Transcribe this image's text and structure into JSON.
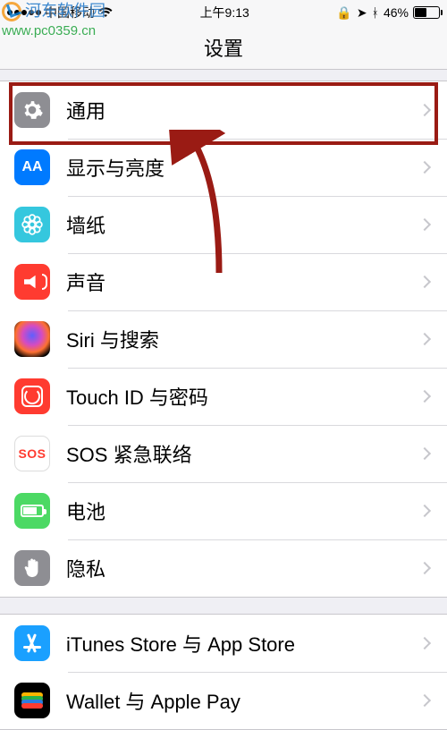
{
  "watermark": {
    "text": "河东软件园",
    "url": "www.pc0359.cn"
  },
  "status": {
    "carrier": "中国移动",
    "time": "上午9:13",
    "orientation_lock": "⊕",
    "location": "➤",
    "bluetooth": "✱",
    "battery_pct": "46%"
  },
  "title": "设置",
  "groups": [
    {
      "items": [
        {
          "key": "general",
          "label": "通用",
          "icon": "gear-icon",
          "bg": "bg-gray"
        },
        {
          "key": "display",
          "label": "显示与亮度",
          "icon": "display-icon",
          "bg": "bg-blue"
        },
        {
          "key": "wallpaper",
          "label": "墙纸",
          "icon": "wallpaper-icon",
          "bg": "bg-cyan"
        },
        {
          "key": "sound",
          "label": "声音",
          "icon": "sound-icon",
          "bg": "bg-red"
        },
        {
          "key": "siri",
          "label": "Siri 与搜索",
          "icon": "siri-icon",
          "bg": "bg-black"
        },
        {
          "key": "touchid",
          "label": "Touch ID 与密码",
          "icon": "touchid-icon",
          "bg": "bg-dred"
        },
        {
          "key": "sos",
          "label": "SOS 紧急联络",
          "icon": "sos-icon",
          "bg": "bg-white"
        },
        {
          "key": "battery",
          "label": "电池",
          "icon": "battery-icon",
          "bg": "bg-green"
        },
        {
          "key": "privacy",
          "label": "隐私",
          "icon": "privacy-icon",
          "bg": "bg-hand"
        }
      ]
    },
    {
      "items": [
        {
          "key": "appstore",
          "label": "iTunes Store 与 App Store",
          "icon": "appstore-icon",
          "bg": "bg-store"
        },
        {
          "key": "wallet",
          "label": "Wallet 与 Apple Pay",
          "icon": "wallet-icon",
          "bg": "bg-wallet"
        }
      ]
    }
  ],
  "annotation": {
    "highlight_item": "general",
    "arrow_target": "general",
    "highlight_color": "#9a1b14"
  }
}
